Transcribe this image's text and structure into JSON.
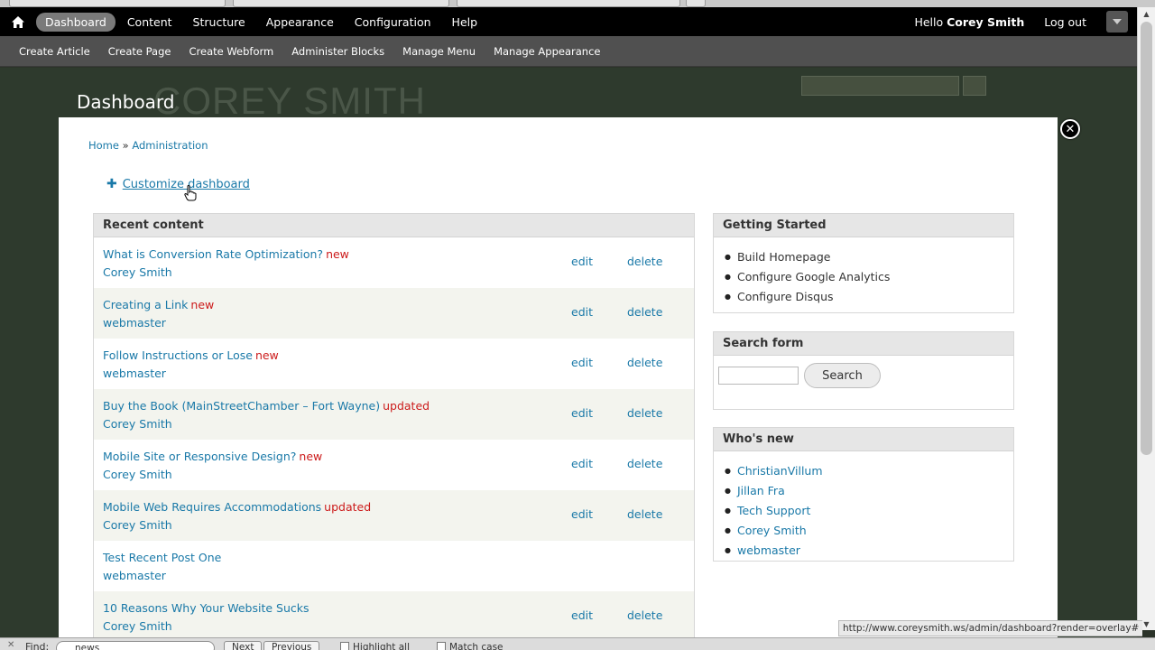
{
  "toolbar": {
    "items": [
      "Dashboard",
      "Content",
      "Structure",
      "Appearance",
      "Configuration",
      "Help"
    ],
    "active": "Dashboard",
    "hello_prefix": "Hello ",
    "user_name": "Corey Smith",
    "logout": "Log out"
  },
  "shortcuts": [
    "Create Article",
    "Create Page",
    "Create Webform",
    "Administer Blocks",
    "Manage Menu",
    "Manage Appearance"
  ],
  "site": {
    "logo_text": "COREY SMITH"
  },
  "overlay": {
    "title": "Dashboard",
    "close_glyph": "✕",
    "breadcrumb": {
      "home": "Home",
      "separator": " » ",
      "admin": "Administration"
    },
    "customize": "Customize dashboard"
  },
  "recent_content": {
    "title": "Recent content",
    "edit_label": "edit",
    "delete_label": "delete",
    "rows": [
      {
        "title": "What is Conversion Rate Optimization?",
        "flag": "new",
        "author": "Corey Smith",
        "actions": true
      },
      {
        "title": "Creating a Link",
        "flag": "new",
        "author": "webmaster",
        "actions": true
      },
      {
        "title": "Follow Instructions or Lose",
        "flag": "new",
        "author": "webmaster",
        "actions": true
      },
      {
        "title": "Buy the Book (MainStreetChamber – Fort Wayne)",
        "flag": "updated",
        "author": "Corey Smith",
        "actions": true
      },
      {
        "title": "Mobile Site or Responsive Design?",
        "flag": "new",
        "author": "Corey Smith",
        "actions": true
      },
      {
        "title": "Mobile Web Requires Accommodations",
        "flag": "updated",
        "author": "Corey Smith",
        "actions": true
      },
      {
        "title": "Test Recent Post One",
        "flag": "",
        "author": "webmaster",
        "actions": false
      },
      {
        "title": "10 Reasons Why Your Website Sucks",
        "flag": "",
        "author": "Corey Smith",
        "actions": true
      }
    ]
  },
  "getting_started": {
    "title": "Getting Started",
    "items": [
      "Build Homepage",
      "Configure Google Analytics",
      "Configure Disqus"
    ]
  },
  "search_form": {
    "title": "Search form",
    "input_value": "",
    "button": "Search"
  },
  "whos_new": {
    "title": "Who's new",
    "items": [
      "ChristianVillum",
      "Jillan Fra",
      "Tech Support",
      "Corey Smith",
      "webmaster"
    ]
  },
  "status_url": "http://www.coreysmith.ws/admin/dashboard?render=overlay#",
  "findbar": {
    "close": "✕",
    "label": "Find:",
    "query": "news",
    "next": "Next",
    "previous": "Previous",
    "highlight_all": "Highlight all",
    "match_case": "Match case"
  },
  "colors": {
    "link": "#1a79a8",
    "flag": "#cc1b1b",
    "toolbar": "#000000",
    "shortcut_bar": "#505050",
    "site_bg": "#2e3a2d"
  }
}
